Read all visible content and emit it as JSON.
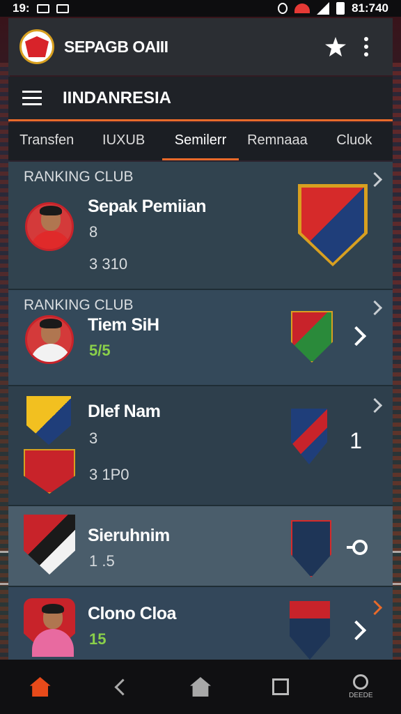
{
  "status_bar": {
    "time_left": "19:",
    "time_right": "81:740"
  },
  "app_bar": {
    "title": "SEPAGB OAIII"
  },
  "sub_bar": {
    "region": "IINDANRESIA"
  },
  "tabs": [
    "Transfen",
    "IUXUB",
    "Semilerr",
    "Remnaaa",
    "Cluok"
  ],
  "active_tab_index": 2,
  "cards": [
    {
      "section": "RANKING CLUB",
      "name": "Sepak Pemiian",
      "line1": "8",
      "line2": "3 310"
    },
    {
      "section": "RANKING CLUB",
      "name": "Tiem SiH",
      "line1": "5/5"
    },
    {
      "name": "Dlef Nam",
      "line1": "3",
      "line2": "3 1P0",
      "trail": "1"
    },
    {
      "name": "Sieruhnim",
      "line1": "1 .5"
    },
    {
      "name": "Clono Cloa",
      "line1": "15"
    }
  ],
  "nav": {
    "profile_label": "DEEDE"
  },
  "colors": {
    "accent": "#e86a2a",
    "home_active": "#e84a1a",
    "green_value": "#8ad04a"
  },
  "icons": [
    "home-icon",
    "back-icon",
    "home-outline-icon",
    "square-icon",
    "profile-icon",
    "star-icon",
    "menu-icon",
    "more-icon"
  ]
}
